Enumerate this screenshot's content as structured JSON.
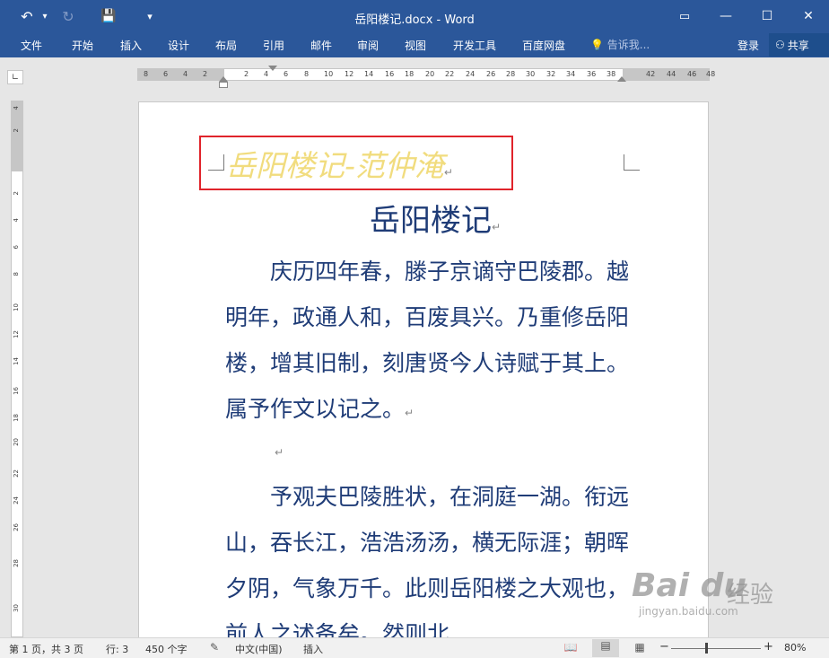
{
  "window": {
    "title": "岳阳楼记.docx - Word",
    "quick_access": {
      "undo": "↶",
      "redo": "↻",
      "save": "💾",
      "customize": "▾"
    },
    "buttons": {
      "ribbon_display": "▭",
      "minimize": "—",
      "maximize": "☐",
      "close": "✕"
    }
  },
  "ribbon": {
    "tabs": [
      "文件",
      "开始",
      "插入",
      "设计",
      "布局",
      "引用",
      "邮件",
      "审阅",
      "视图",
      "开发工具",
      "百度网盘"
    ],
    "tell_me_placeholder": "告诉我...",
    "login": "登录",
    "share": "共享"
  },
  "rulers": {
    "horizontal_ticks": [
      "8",
      "6",
      "4",
      "2",
      "2",
      "4",
      "6",
      "8",
      "10",
      "12",
      "14",
      "16",
      "18",
      "20",
      "22",
      "24",
      "26",
      "28",
      "30",
      "32",
      "34",
      "36",
      "38",
      "42",
      "44",
      "46",
      "48"
    ],
    "vertical_ticks": [
      "4",
      "2",
      "2",
      "4",
      "6",
      "8",
      "10",
      "12",
      "14",
      "16",
      "18",
      "20",
      "22",
      "24",
      "26",
      "28",
      "30"
    ]
  },
  "document": {
    "header_text": "岳阳楼记-范仲淹",
    "heading": "岳阳楼记",
    "paragraphs": [
      "　　庆历四年春，滕子京谪守巴陵郡。越明年，政通人和，百废具兴。乃重修岳阳楼，增其旧制，刻唐贤今人诗赋于其上。属予作文以记之。",
      "　　予观夫巴陵胜状，在洞庭一湖。衔远山，吞长江，浩浩汤汤，横无际涯；朝晖夕阴，气象万千。此则岳阳楼之大观也，前人之述备矣。然则北"
    ],
    "paragraph_mark": "↵"
  },
  "status": {
    "page": "第 1 页，共 3 页",
    "line": "行: 3",
    "words": "450 个字",
    "language": "中文(中国)",
    "mode": "插入",
    "zoom_minus": "−",
    "zoom_plus": "+",
    "zoom": "80%"
  },
  "watermark": {
    "logo": "Bai du",
    "text": "经验",
    "url": "jingyan.baidu.com"
  },
  "colors": {
    "ribbon": "#2b579a",
    "body_text": "#1f3c77",
    "header_text": "#f1dc7e",
    "highlight_box": "#e0242b"
  }
}
